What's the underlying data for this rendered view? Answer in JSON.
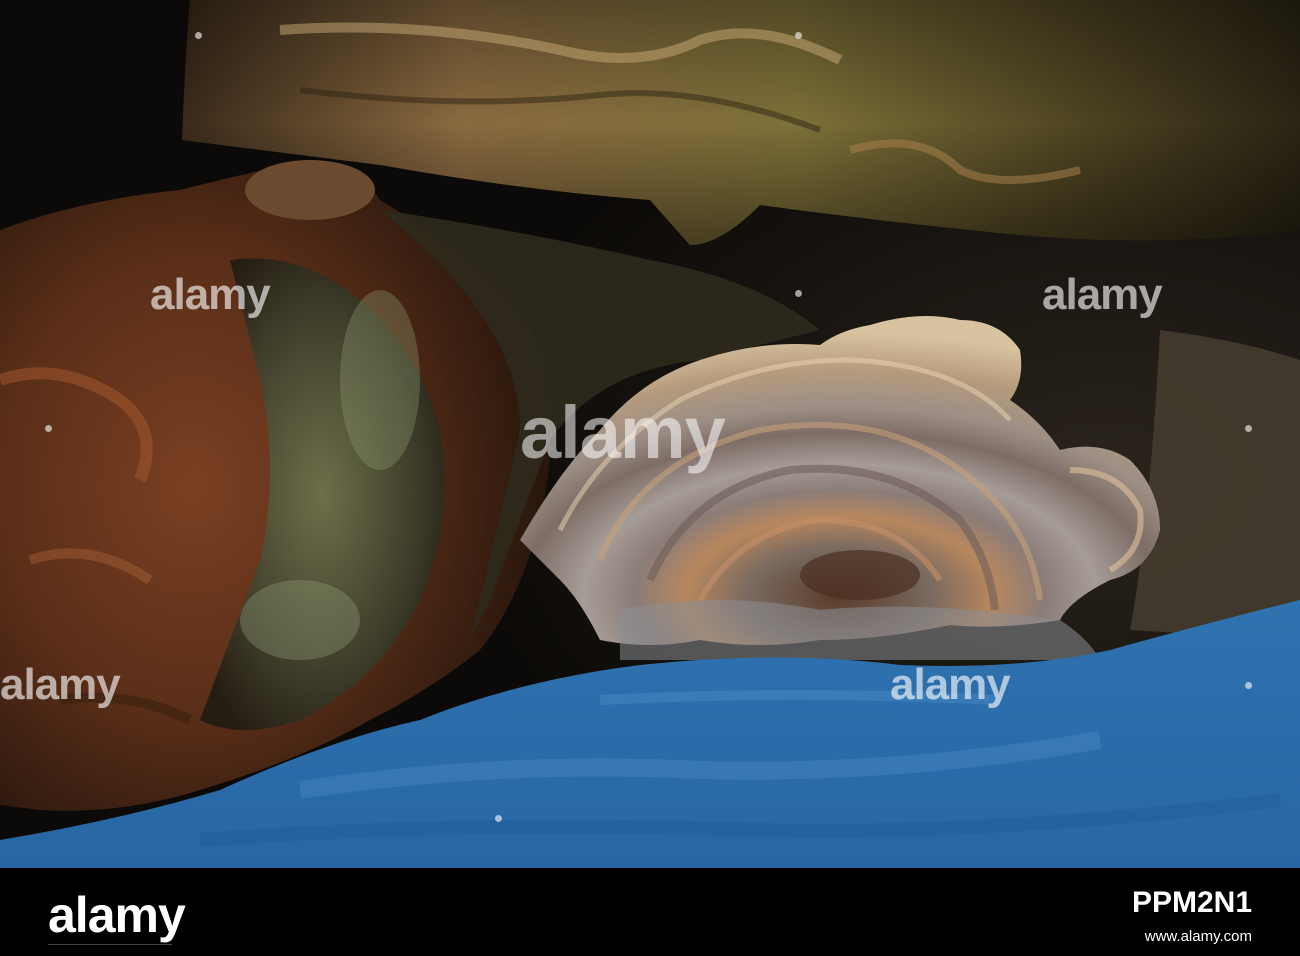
{
  "watermark": {
    "text": "alamy"
  },
  "footer": {
    "logo": "alamy",
    "image_id": "PPM2N1",
    "url": "www.alamy.com"
  },
  "scene": {
    "elements": [
      "rotting-log",
      "bracket-fungus",
      "lichen-covered-bark",
      "blue-surface"
    ]
  }
}
